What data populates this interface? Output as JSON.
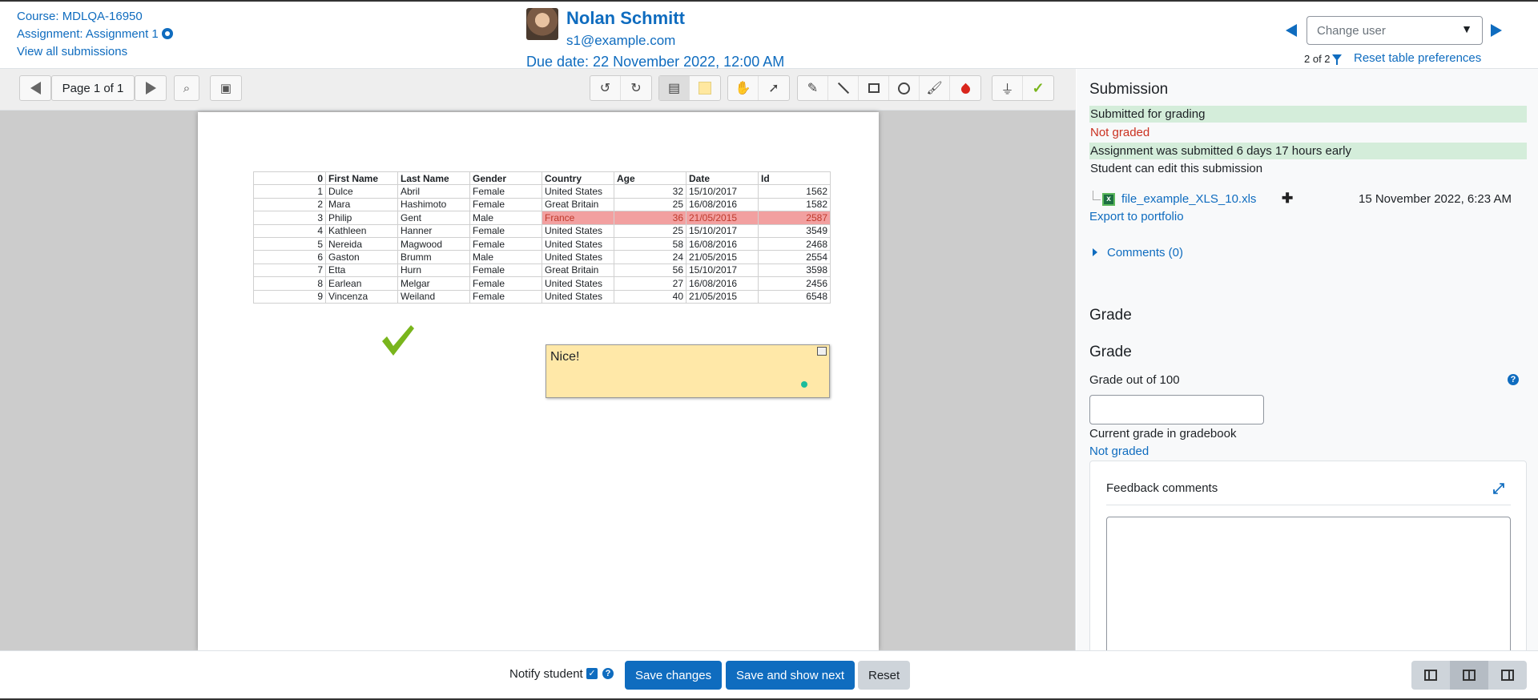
{
  "header": {
    "course": "Course: MDLQA-16950",
    "assignment": "Assignment: Assignment 1",
    "view_all": "View all submissions",
    "user_name": "Nolan Schmitt",
    "user_email": "s1@example.com",
    "due_date": "Due date: 22 November 2022, 12:00 AM",
    "change_user_placeholder": "Change user",
    "user_count": "2 of 2",
    "reset_prefs": "Reset table preferences"
  },
  "pdf_toolbar": {
    "page_label": "Page 1 of 1"
  },
  "pdf": {
    "table": {
      "headers": [
        "0",
        "First Name",
        "Last Name",
        "Gender",
        "Country",
        "Age",
        "Date",
        "Id"
      ],
      "rows": [
        [
          "1",
          "Dulce",
          "Abril",
          "Female",
          "United States",
          "32",
          "15/10/2017",
          "1562"
        ],
        [
          "2",
          "Mara",
          "Hashimoto",
          "Female",
          "Great Britain",
          "25",
          "16/08/2016",
          "1582"
        ],
        [
          "3",
          "Philip",
          "Gent",
          "Male",
          "France",
          "36",
          "21/05/2015",
          "2587"
        ],
        [
          "4",
          "Kathleen",
          "Hanner",
          "Female",
          "United States",
          "25",
          "15/10/2017",
          "3549"
        ],
        [
          "5",
          "Nereida",
          "Magwood",
          "Female",
          "United States",
          "58",
          "16/08/2016",
          "2468"
        ],
        [
          "6",
          "Gaston",
          "Brumm",
          "Male",
          "United States",
          "24",
          "21/05/2015",
          "2554"
        ],
        [
          "7",
          "Etta",
          "Hurn",
          "Female",
          "Great Britain",
          "56",
          "15/10/2017",
          "3598"
        ],
        [
          "8",
          "Earlean",
          "Melgar",
          "Female",
          "United States",
          "27",
          "16/08/2016",
          "2456"
        ],
        [
          "9",
          "Vincenza",
          "Weiland",
          "Female",
          "United States",
          "40",
          "21/05/2015",
          "6548"
        ]
      ],
      "highlight_row": 2
    },
    "comment_text": "Nice!"
  },
  "submission": {
    "title": "Submission",
    "status_grading": "Submitted for grading",
    "status_graded": "Not graded",
    "status_time": "Assignment was submitted 6 days 17 hours early",
    "status_edit": "Student can edit this submission",
    "file_name": "file_example_XLS_10.xls",
    "file_date": "15 November 2022, 6:23 AM",
    "export": "Export to portfolio",
    "comments": "Comments (0)"
  },
  "grade": {
    "section_title": "Grade",
    "subsection_title": "Grade",
    "grade_label": "Grade out of 100",
    "current_label": "Current grade in gradebook",
    "current_value": "Not graded",
    "feedback_title": "Feedback comments"
  },
  "footer": {
    "notify": "Notify student",
    "save": "Save changes",
    "save_next": "Save and show next",
    "reset": "Reset"
  },
  "colors": {
    "accent": "#0f6cbf",
    "status_green": "#d4edda",
    "status_red": "#ca3120",
    "highlight": "#f2a0a0",
    "comment_bg": "#ffe8a8"
  }
}
